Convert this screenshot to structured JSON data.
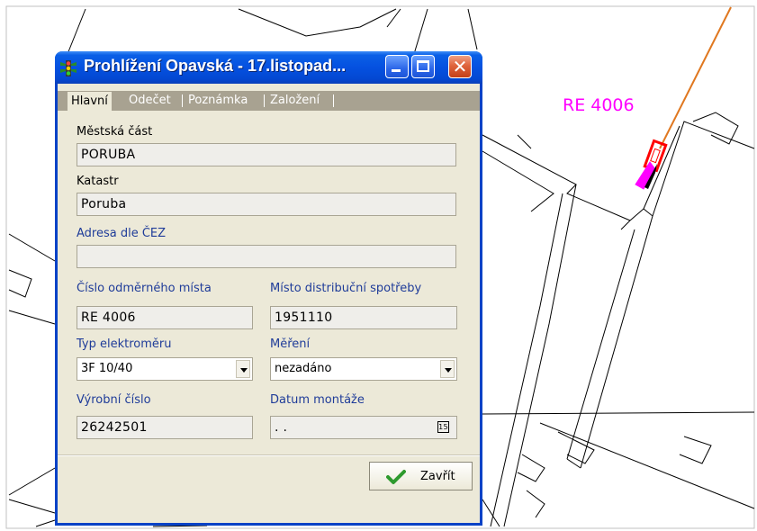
{
  "map": {
    "label": "RE 4006",
    "label_color": "#ff00ff",
    "line_color": "#e07820",
    "marker_color": "#ff0000"
  },
  "dialog": {
    "title": "Prohlížení Opavská - 17.listopad...",
    "tabs": [
      "Hlavní",
      "Odečet",
      "Poznámka",
      "Založení"
    ],
    "fields": {
      "mestska_cast": {
        "label": "Městská část",
        "value": "PORUBA"
      },
      "katastr": {
        "label": "Katastr",
        "value": "Poruba"
      },
      "adresa": {
        "label": "Adresa dle ČEZ",
        "value": ""
      },
      "cislo_mista": {
        "label": "Číslo odměrného místa",
        "value": "RE 4006"
      },
      "misto_spotreby": {
        "label": "Místo distribuční spotřeby",
        "value": "1951110"
      },
      "typ": {
        "label": "Typ elektroměru",
        "value": "3F 10/40"
      },
      "mereni": {
        "label": "Měření",
        "value": "nezadáno"
      },
      "vyrobni": {
        "label": "Výrobní číslo",
        "value": "26242501"
      },
      "datum": {
        "label": "Datum montáže",
        "value": ". .",
        "calendar": "15"
      }
    },
    "close_button": "Zavřít"
  }
}
